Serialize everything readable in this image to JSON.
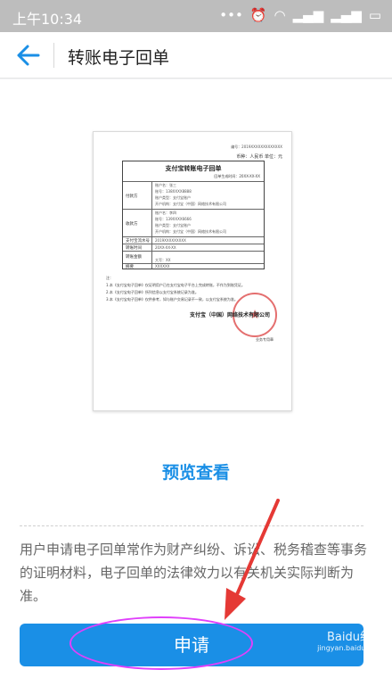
{
  "status": {
    "time": "上午10:34",
    "icons": [
      "...",
      "alarm-icon",
      "wifi-icon",
      "signal-icon",
      "signal-icon",
      "battery-icon"
    ]
  },
  "nav": {
    "title": "转账电子回单"
  },
  "receipt": {
    "serial": "编号：2019XXXXXXXXXXXXX",
    "currency": "币种：人民币  单位：元",
    "title": "支付宝转账电子回单",
    "date": "回单生成时间：20XX-XX-XX",
    "payer_label": "付款方",
    "payer_lines": [
      "账户名：张三",
      "账号：138XXXX8888",
      "账户类型：支付宝账户",
      "开户机构：支付宝（中国）网络技术有限公司"
    ],
    "payee_label": "收款方",
    "payee_lines": [
      "账户名：李四",
      "账号：139XXXX6666",
      "账户类型：支付宝账户",
      "开户机构：支付宝（中国）网络技术有限公司"
    ],
    "trade_label": "支付宝流水号",
    "trade_value": "2019XXXXXXXXX",
    "time_label": "转账时间",
    "time_value": "20XX-XX-XX",
    "amount_label": "转账金额",
    "amount_value": "大写：XX",
    "memo_label": "摘要",
    "memo_value": "XXXXXX",
    "notes": [
      "注：",
      "1.本《支付宝电子回单》仅证明用户已在支付宝电子平台上完成转账，不作为到账凭证。",
      "2.本《支付宝电子回单》所列信息以支付宝系统记录为准。",
      "3.本《支付宝电子回单》仅供参考，如与账户交易记录不一致，以支付宝系统为准。"
    ],
    "company": "支付宝（中国）网络技术有限公司",
    "stamp_note": "业务专用章"
  },
  "actions": {
    "preview": "预览查看",
    "apply": "申请"
  },
  "description": "用户申请电子回单常作为财产纠纷、诉讼、税务稽查等事务的证明材料，电子回单的法律效力以有关机关实际判断为准。",
  "watermark": {
    "main": "Baidu经验",
    "sub": "jingyan.baidu.com"
  },
  "colors": {
    "accent": "#1a8fe6",
    "highlight": "#e040fb",
    "arrow": "#e53935"
  }
}
